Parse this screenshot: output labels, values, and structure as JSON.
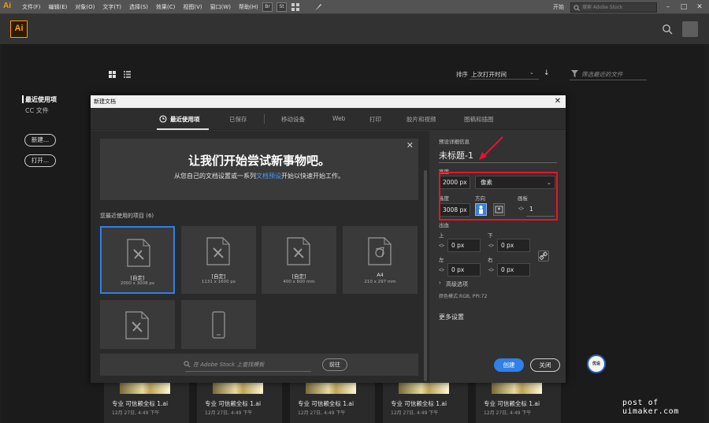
{
  "menubar": {
    "app_logo": "Ai",
    "items": [
      "文件(F)",
      "编辑(E)",
      "对象(O)",
      "文字(T)",
      "选择(S)",
      "效果(C)",
      "视图(V)",
      "窗口(W)",
      "帮助(H)"
    ],
    "bridge_label": "Br",
    "stock_label": "St",
    "workspace_label": "开始",
    "stock_search_placeholder": "搜索 Adobe Stock"
  },
  "header": {
    "logo": "Ai"
  },
  "start": {
    "recent_label": "最近使用项",
    "cc_files_label": "CC 文件",
    "new_button": "新建...",
    "open_button": "打开...",
    "sort_label": "排序",
    "sort_value": "上次打开时间",
    "filter_placeholder": "筛选最近的文件",
    "recent_files": [
      {
        "name": "专业 可信赖全标 1.ai",
        "time": "12月 27日, 4:49 下午"
      },
      {
        "name": "专业 可信赖全标 1.ai",
        "time": "12月 27日, 4:49 下午"
      },
      {
        "name": "专业 可信赖全标 1.ai",
        "time": "12月 27日, 4:49 下午"
      },
      {
        "name": "专业 可信赖全标 1.ai",
        "time": "12月 27日, 4:49 下午"
      },
      {
        "name": "专业 可信赖全标 1.ai",
        "time": "12月 27日, 4:49 下午"
      }
    ]
  },
  "dialog": {
    "title": "新建文档",
    "tabs": [
      "最近使用项",
      "已保存",
      "移动设备",
      "Web",
      "打印",
      "胶片和视频",
      "图稿和插图"
    ],
    "banner_title": "让我们开始尝试新事物吧。",
    "banner_sub_1": "从您自己的文档设置或一系列",
    "banner_sub_link": "文档预设",
    "banner_sub_2": "开始以快速开始工作。",
    "recent_items_label": "您最近使用的项目",
    "recent_items_count": "(6)",
    "tiles": [
      {
        "name": "[自定]",
        "size": "2000 x 3008 px"
      },
      {
        "name": "[自定]",
        "size": "1131 x 1600 px"
      },
      {
        "name": "[自定]",
        "size": "400 x 600 mm"
      },
      {
        "name": "A4",
        "size": "210 x 297 mm"
      },
      {
        "name": "",
        "size": ""
      },
      {
        "name": "",
        "size": ""
      }
    ],
    "stock_placeholder": "在 Adobe Stock 上查找模板",
    "stock_go": "前往",
    "preset_details_label": "预设详细信息",
    "doc_name": "未标题-1",
    "width_label": "宽度",
    "width_value": "2000 px",
    "unit_value": "像素",
    "height_label": "高度",
    "height_value": "3008 px",
    "orientation_label": "方向",
    "artboards_label": "画板",
    "artboards_value": "1",
    "bleed_label": "出血",
    "top_label": "上",
    "bottom_label": "下",
    "left_label": "左",
    "right_label": "右",
    "bleed_top": "0 px",
    "bleed_bottom": "0 px",
    "bleed_left": "0 px",
    "bleed_right": "0 px",
    "advanced_label": "高级选项",
    "color_mode": "颜色模式:RGB, PPI:72",
    "more_settings": "更多设置",
    "create_button": "创建",
    "close_button": "关闭"
  },
  "watermark": {
    "logo_text": "优设",
    "text": "post of uimaker.com"
  },
  "colors": {
    "accent": "#2f80e8",
    "highlight": "#e8142a",
    "ai_orange": "#ff9a00"
  }
}
